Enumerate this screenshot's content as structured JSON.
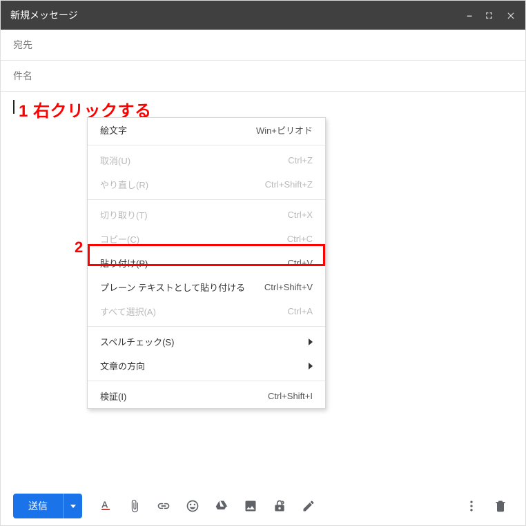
{
  "titlebar": {
    "title": "新規メッセージ"
  },
  "fields": {
    "to_label": "宛先",
    "subject_label": "件名"
  },
  "annotations": {
    "step1": "1 右クリックする",
    "step2": "2"
  },
  "context_menu": {
    "items": [
      {
        "label": "絵文字",
        "shortcut": "Win+ピリオド",
        "disabled": false,
        "submenu": false
      },
      {
        "sep": true
      },
      {
        "label": "取消(U)",
        "shortcut": "Ctrl+Z",
        "disabled": true,
        "submenu": false
      },
      {
        "label": "やり直し(R)",
        "shortcut": "Ctrl+Shift+Z",
        "disabled": true,
        "submenu": false
      },
      {
        "sep": true
      },
      {
        "label": "切り取り(T)",
        "shortcut": "Ctrl+X",
        "disabled": true,
        "submenu": false
      },
      {
        "label": "コピー(C)",
        "shortcut": "Ctrl+C",
        "disabled": true,
        "submenu": false
      },
      {
        "label": "貼り付け(P)",
        "shortcut": "Ctrl+V",
        "disabled": false,
        "submenu": false
      },
      {
        "label": "プレーン テキストとして貼り付ける",
        "shortcut": "Ctrl+Shift+V",
        "disabled": false,
        "submenu": false
      },
      {
        "label": "すべて選択(A)",
        "shortcut": "Ctrl+A",
        "disabled": true,
        "submenu": false
      },
      {
        "sep": true
      },
      {
        "label": "スペルチェック(S)",
        "shortcut": "",
        "disabled": false,
        "submenu": true
      },
      {
        "label": "文章の方向",
        "shortcut": "",
        "disabled": false,
        "submenu": true
      },
      {
        "sep": true
      },
      {
        "label": "検証(I)",
        "shortcut": "Ctrl+Shift+I",
        "disabled": false,
        "submenu": false
      }
    ]
  },
  "toolbar": {
    "send_label": "送信"
  }
}
